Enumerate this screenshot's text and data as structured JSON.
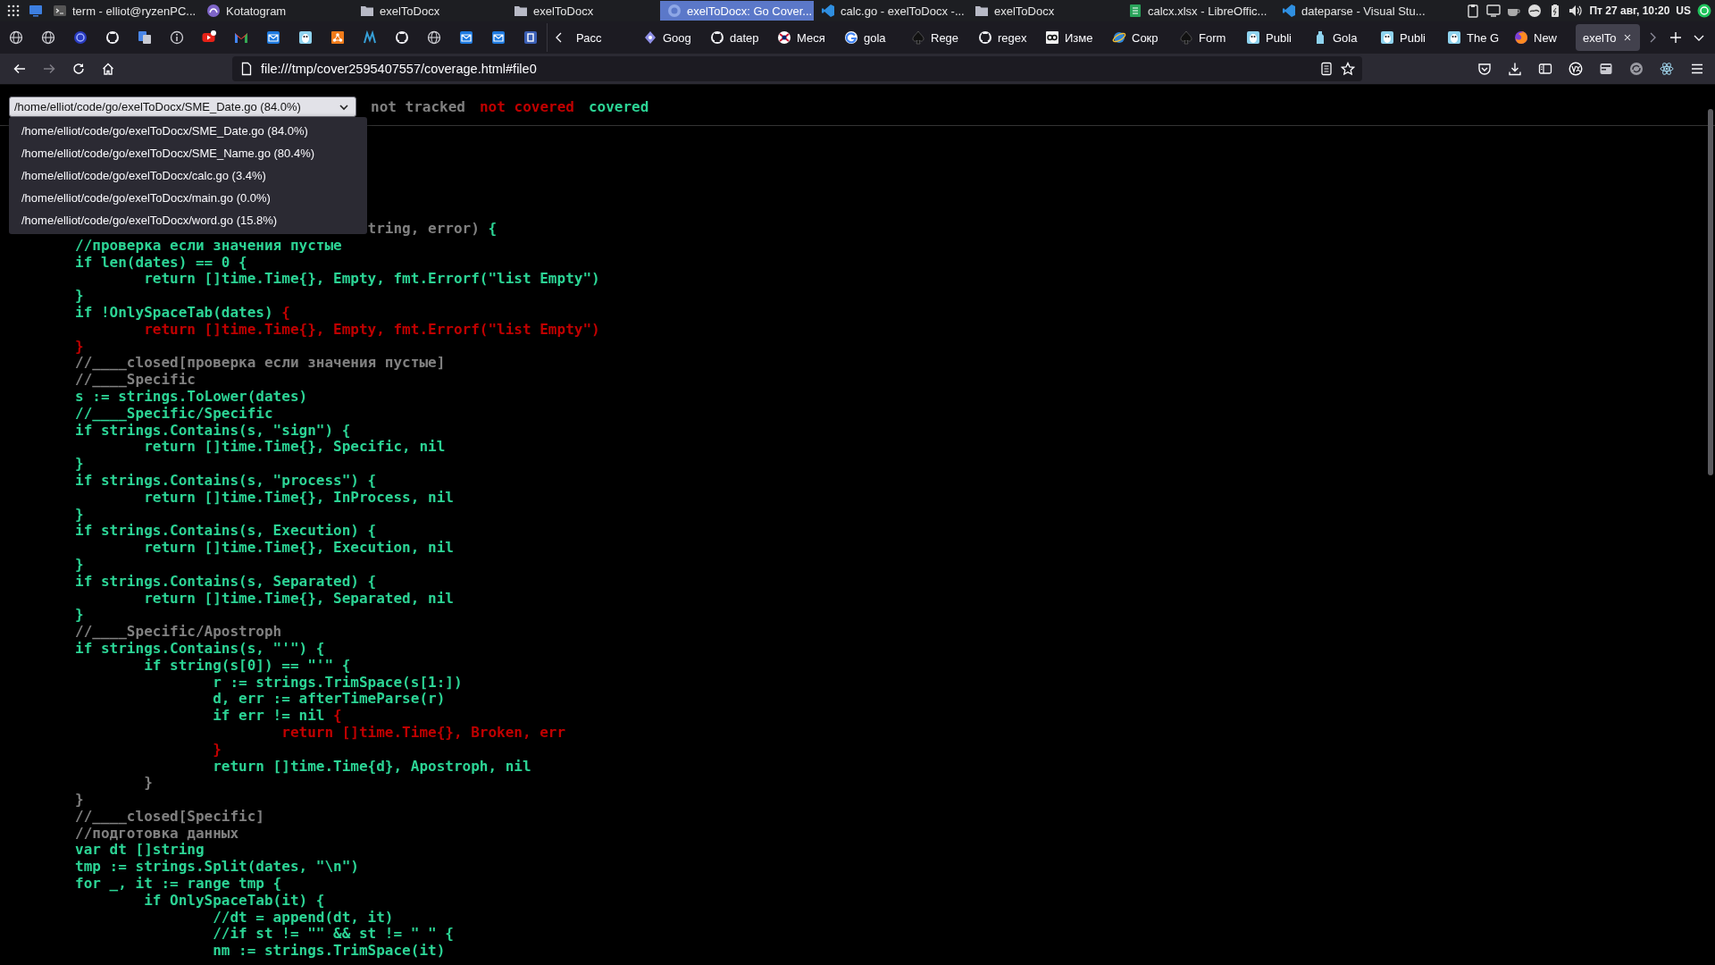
{
  "taskbar": {
    "windows": [
      {
        "title": "term - elliot@ryzenPC...",
        "kind": "terminal",
        "selected": false
      },
      {
        "title": "Kotatogram",
        "kind": "chat",
        "selected": false
      },
      {
        "title": "exelToDocx",
        "kind": "folder",
        "selected": false
      },
      {
        "title": "exelToDocx",
        "kind": "folder",
        "selected": false
      },
      {
        "title": "exelToDocx: Go Cover...",
        "kind": "browser",
        "selected": true
      },
      {
        "title": "calc.go - exelToDocx -...",
        "kind": "editor",
        "selected": false
      },
      {
        "title": "exelToDocx",
        "kind": "folder",
        "selected": false
      },
      {
        "title": "calcx.xlsx - LibreOffic...",
        "kind": "spreadsheet",
        "selected": false
      },
      {
        "title": "dateparse - Visual Stu...",
        "kind": "editor",
        "selected": false
      }
    ],
    "clock": "Пт 27 авг, 10:20",
    "keyboard_layout": "US"
  },
  "browser": {
    "pinned_tabs": [
      {
        "kind": "globe"
      },
      {
        "kind": "globe"
      },
      {
        "kind": "swirl"
      },
      {
        "kind": "cat"
      },
      {
        "kind": "translate"
      },
      {
        "kind": "info"
      },
      {
        "kind": "play"
      },
      {
        "kind": "envelope"
      },
      {
        "kind": "mail"
      },
      {
        "kind": "mascot"
      },
      {
        "kind": "network"
      },
      {
        "kind": "wave"
      },
      {
        "kind": "cat"
      },
      {
        "kind": "globe"
      },
      {
        "kind": "mail"
      },
      {
        "kind": "mail"
      },
      {
        "kind": "square"
      }
    ],
    "tabs": [
      {
        "title": "Расс",
        "kind": "none",
        "selected": false
      },
      {
        "title": "Goog",
        "kind": "diamond",
        "selected": false
      },
      {
        "title": "datep",
        "kind": "cat",
        "selected": false
      },
      {
        "title": "Меся",
        "kind": "flag",
        "selected": false
      },
      {
        "title": "gola",
        "kind": "ring",
        "selected": false
      },
      {
        "title": "Rege",
        "kind": "spade",
        "selected": false
      },
      {
        "title": "regex",
        "kind": "cat",
        "selected": false
      },
      {
        "title": "Изме",
        "kind": "badge",
        "selected": false
      },
      {
        "title": "Сокр",
        "kind": "orbit",
        "selected": false
      },
      {
        "title": "Form",
        "kind": "spade",
        "selected": false
      },
      {
        "title": "Publi",
        "kind": "mascot",
        "selected": false
      },
      {
        "title": "Gola",
        "kind": "bottle",
        "selected": false
      },
      {
        "title": "Publi",
        "kind": "mascot",
        "selected": false
      },
      {
        "title": "The G",
        "kind": "mascot",
        "selected": false
      },
      {
        "title": "New",
        "kind": "fox",
        "selected": false
      },
      {
        "title": "exelTo",
        "kind": "none",
        "selected": true
      }
    ],
    "url": "file:///tmp/cover2595407557/coverage.html#file0"
  },
  "coverage": {
    "file_select": {
      "value": "/home/elliot/code/go/exelToDocx/SME_Date.go (84.0%)",
      "expanded": true,
      "options": [
        "/home/elliot/code/go/exelToDocx/SME_Date.go (84.0%)",
        "/home/elliot/code/go/exelToDocx/SME_Name.go (80.4%)",
        "/home/elliot/code/go/exelToDocx/calc.go (3.4%)",
        "/home/elliot/code/go/exelToDocx/main.go (0.0%)",
        "/home/elliot/code/go/exelToDocx/word.go (15.8%)"
      ]
    },
    "legend": [
      {
        "label": "not tracked",
        "kind": "not_tracked"
      },
      {
        "label": "not covered",
        "kind": "not_covered"
      },
      {
        "label": "covered",
        "kind": "covered"
      }
    ],
    "lines": [
      [
        {
          "text": "\t\t\t\t\t  tring, error) ",
          "kind": "not_tracked"
        },
        {
          "text": "{",
          "kind": "covered"
        }
      ],
      [
        {
          "text": "\t//проверка если значения пустые",
          "kind": "covered"
        }
      ],
      [
        {
          "text": "\tif len(dates) == 0 {",
          "kind": "covered"
        }
      ],
      [
        {
          "text": "\t\treturn []time.Time{}, Empty, fmt.Errorf(\"list Empty\")",
          "kind": "covered"
        }
      ],
      [
        {
          "text": "\t}",
          "kind": "covered"
        }
      ],
      [
        {
          "text": "\tif !OnlySpaceTab(dates) ",
          "kind": "covered"
        },
        {
          "text": "{",
          "kind": "not_covered"
        }
      ],
      [
        {
          "text": "\t\treturn []time.Time{}, Empty, fmt.Errorf(\"list Empty\")",
          "kind": "not_covered"
        }
      ],
      [
        {
          "text": "\t}",
          "kind": "not_covered"
        }
      ],
      [
        {
          "text": "\t//____closed[проверка если значения пустые]",
          "kind": "not_tracked"
        }
      ],
      [
        {
          "text": "\t//____Specific",
          "kind": "not_tracked"
        }
      ],
      [
        {
          "text": "\ts := strings.ToLower(dates)",
          "kind": "covered"
        }
      ],
      [
        {
          "text": "\t//____Specific/Specific",
          "kind": "covered"
        }
      ],
      [
        {
          "text": "\tif strings.Contains(s, \"sign\") {",
          "kind": "covered"
        }
      ],
      [
        {
          "text": "\t\treturn []time.Time{}, Specific, nil",
          "kind": "covered"
        }
      ],
      [
        {
          "text": "\t}",
          "kind": "covered"
        }
      ],
      [
        {
          "text": "\tif strings.Contains(s, \"process\") {",
          "kind": "covered"
        }
      ],
      [
        {
          "text": "\t\treturn []time.Time{}, InProcess, nil",
          "kind": "covered"
        }
      ],
      [
        {
          "text": "\t}",
          "kind": "covered"
        }
      ],
      [
        {
          "text": "\tif strings.Contains(s, Execution) {",
          "kind": "covered"
        }
      ],
      [
        {
          "text": "\t\treturn []time.Time{}, Execution, nil",
          "kind": "covered"
        }
      ],
      [
        {
          "text": "\t}",
          "kind": "covered"
        }
      ],
      [
        {
          "text": "\tif strings.Contains(s, Separated) {",
          "kind": "covered"
        }
      ],
      [
        {
          "text": "\t\treturn []time.Time{}, Separated, nil",
          "kind": "covered"
        }
      ],
      [
        {
          "text": "\t}",
          "kind": "covered"
        }
      ],
      [
        {
          "text": "\t//____Specific/Apostroph",
          "kind": "not_tracked"
        }
      ],
      [
        {
          "text": "\tif strings.Contains(s, \"'\") {",
          "kind": "covered"
        }
      ],
      [
        {
          "text": "\t\tif string(s[0]) == \"'\" {",
          "kind": "covered"
        }
      ],
      [
        {
          "text": "\t\t\tr := strings.TrimSpace(s[1:])",
          "kind": "covered"
        }
      ],
      [
        {
          "text": "\t\t\td, err := afterTimeParse(r)",
          "kind": "covered"
        }
      ],
      [
        {
          "text": "\t\t\tif err != nil ",
          "kind": "covered"
        },
        {
          "text": "{",
          "kind": "not_covered"
        }
      ],
      [
        {
          "text": "\t\t\t\treturn []time.Time{}, Broken, err",
          "kind": "not_covered"
        }
      ],
      [
        {
          "text": "\t\t\t}",
          "kind": "not_covered"
        }
      ],
      [
        {
          "text": "\t\t\treturn []time.Time{d}, Apostroph, nil",
          "kind": "covered"
        }
      ],
      [
        {
          "text": "\t\t}",
          "kind": "not_tracked"
        }
      ],
      [
        {
          "text": "\t}",
          "kind": "not_tracked"
        }
      ],
      [
        {
          "text": "\t//____closed[Specific]",
          "kind": "not_tracked"
        }
      ],
      [
        {
          "text": "\t//подготовка данных",
          "kind": "not_tracked"
        }
      ],
      [
        {
          "text": "\tvar dt []string",
          "kind": "covered"
        }
      ],
      [
        {
          "text": "\ttmp := strings.Split(dates, \"\\n\")",
          "kind": "covered"
        }
      ],
      [
        {
          "text": "\tfor _, it := range tmp {",
          "kind": "covered"
        }
      ],
      [
        {
          "text": "\t\tif OnlySpaceTab(it) {",
          "kind": "covered"
        }
      ],
      [
        {
          "text": "\t\t\t//dt = append(dt, it)",
          "kind": "covered"
        }
      ],
      [
        {
          "text": "\t\t\t//if st != \"\" && st != \" \" {",
          "kind": "covered"
        }
      ],
      [
        {
          "text": "\t\t\tnm := strings.TrimSpace(it)",
          "kind": "covered"
        }
      ]
    ]
  }
}
